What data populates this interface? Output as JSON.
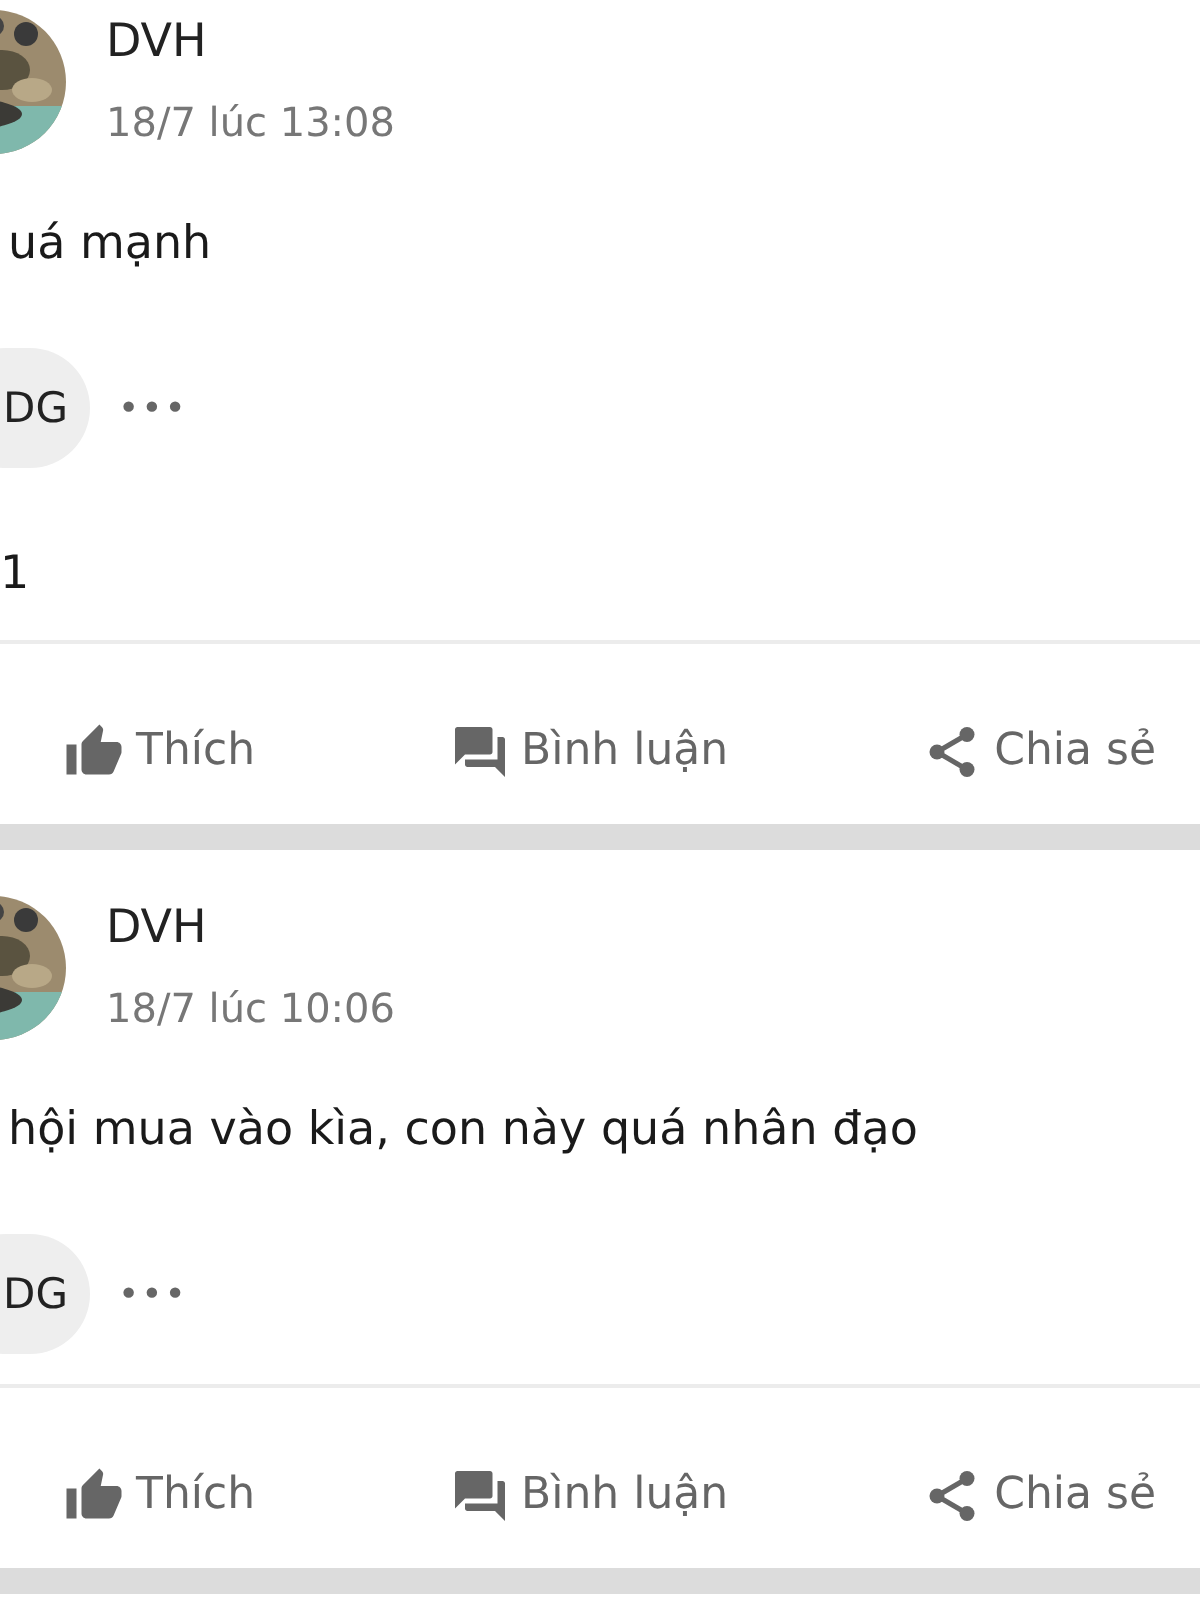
{
  "posts": [
    {
      "author": "DVH",
      "time": "18/7 lúc 13:08",
      "text": "uá mạnh",
      "chip": "DG",
      "more": "•••",
      "extra": "1",
      "actions": [
        {
          "kind": "like",
          "label": "Thích"
        },
        {
          "kind": "comment",
          "label": "Bình luận"
        },
        {
          "kind": "share",
          "label": "Chia sẻ"
        }
      ]
    },
    {
      "author": "DVH",
      "time": "18/7 lúc 10:06",
      "text": "hội mua vào kìa, con này quá nhân đạo",
      "chip": "DG",
      "more": "•••",
      "actions": [
        {
          "kind": "like",
          "label": "Thích"
        },
        {
          "kind": "comment",
          "label": "Bình luận"
        },
        {
          "kind": "share",
          "label": "Chia sẻ"
        }
      ]
    }
  ]
}
